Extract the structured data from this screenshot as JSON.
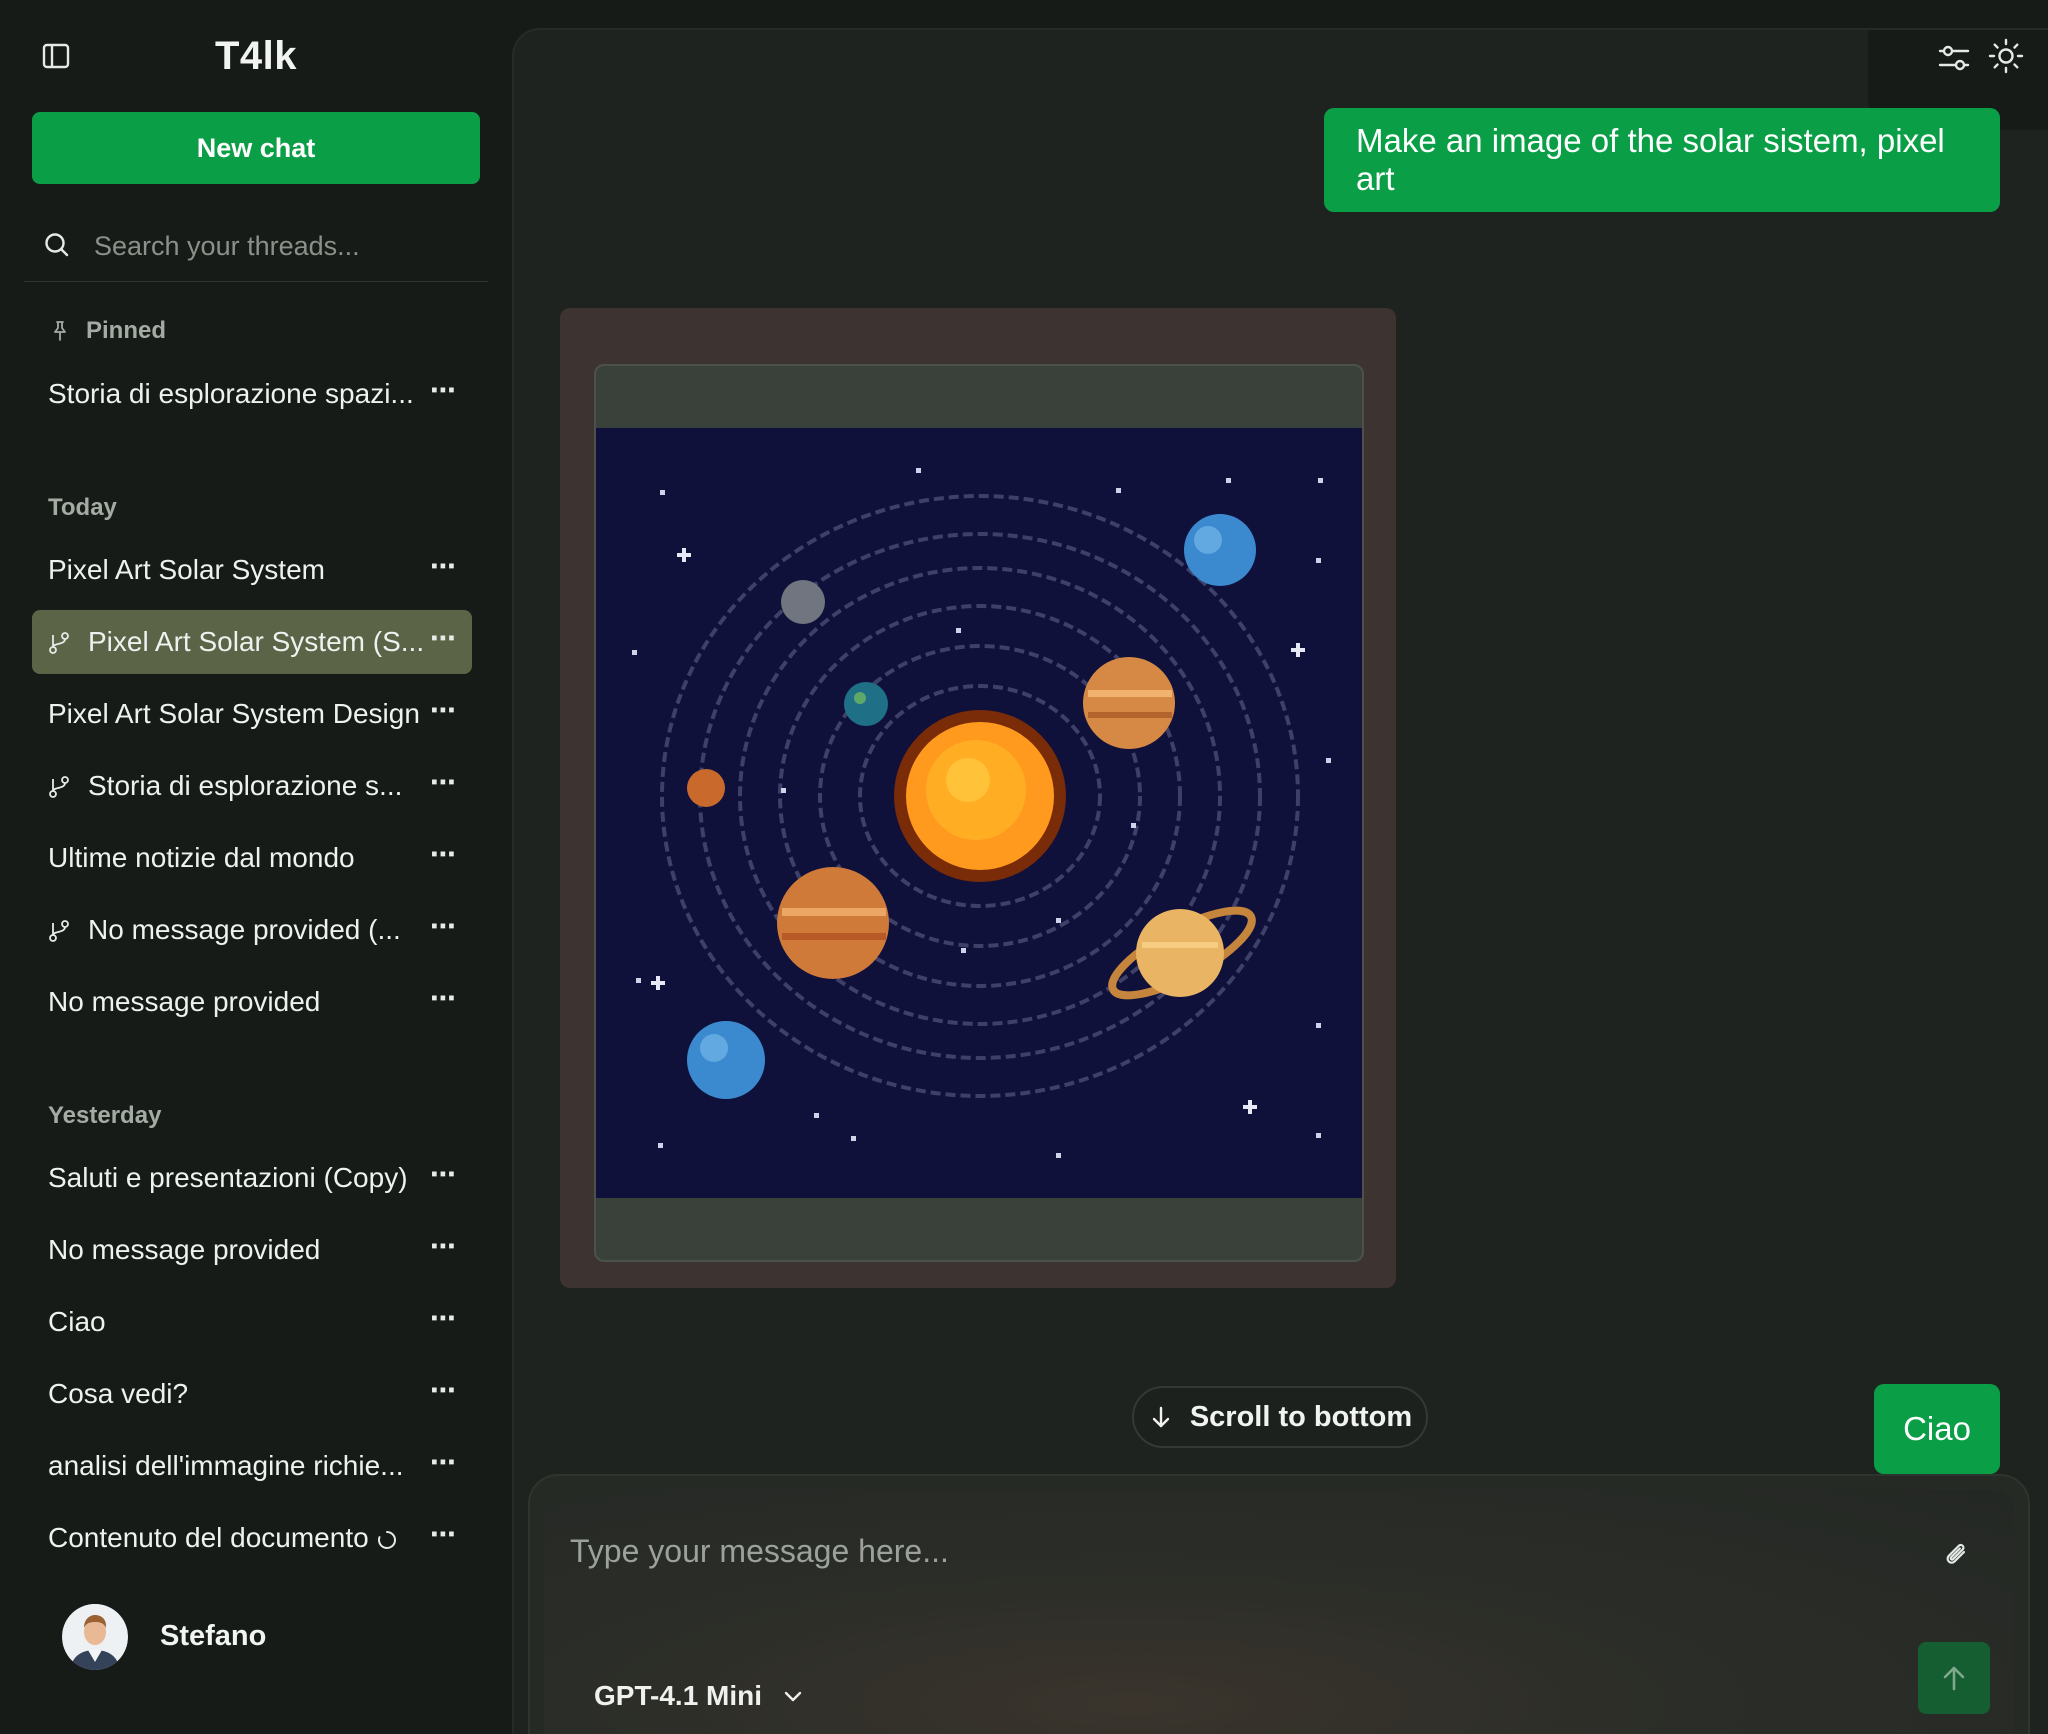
{
  "app": {
    "title": "T4lk"
  },
  "sidebar": {
    "new_chat_label": "New chat",
    "search_placeholder": "Search your threads...",
    "pinned_label": "Pinned",
    "pinned": [
      {
        "label": "Storia di esplorazione spazi...",
        "branch": false
      }
    ],
    "today_label": "Today",
    "today": [
      {
        "label": "Pixel Art Solar System",
        "branch": false,
        "active": false
      },
      {
        "label": "Pixel Art Solar System (S...",
        "branch": true,
        "active": true
      },
      {
        "label": "Pixel Art Solar System Design",
        "branch": false,
        "active": false
      },
      {
        "label": "Storia di esplorazione s...",
        "branch": true,
        "active": false
      },
      {
        "label": "Ultime notizie dal mondo",
        "branch": false,
        "active": false
      },
      {
        "label": "No message provided (...",
        "branch": true,
        "active": false
      },
      {
        "label": "No message provided",
        "branch": false,
        "active": false
      }
    ],
    "yesterday_label": "Yesterday",
    "yesterday": [
      {
        "label": "Saluti e presentazioni (Copy)",
        "branch": false
      },
      {
        "label": "No message provided",
        "branch": false
      },
      {
        "label": "Ciao",
        "branch": false
      },
      {
        "label": "Cosa vedi?",
        "branch": false
      },
      {
        "label": "analisi dell'immagine richie...",
        "branch": false
      },
      {
        "label": "Contenuto del documento",
        "branch": false,
        "loading": true
      }
    ],
    "more_icon": "⋯",
    "user": {
      "name": "Stefano"
    }
  },
  "chat": {
    "messages": [
      {
        "role": "user",
        "text": "Make an image of the solar sistem, pixel art"
      },
      {
        "role": "assistant",
        "type": "image",
        "icon": "generated-image-solar-system"
      },
      {
        "role": "user",
        "text": "Ciao"
      }
    ],
    "scroll_label": "Scroll to bottom",
    "composer": {
      "placeholder": "Type your message here...",
      "model": "GPT-4.1 Mini"
    }
  },
  "icons": {
    "sidebar_toggle": "sidebar-toggle-icon",
    "settings": "sliders-icon",
    "theme": "sun-icon",
    "attach": "paperclip-icon",
    "send": "arrow-up-icon"
  },
  "colors": {
    "accent": "#0a9f47",
    "background": "#171b17",
    "panel": "#1f231f",
    "active_thread": "#5b6447",
    "send_button": "#155e32"
  }
}
